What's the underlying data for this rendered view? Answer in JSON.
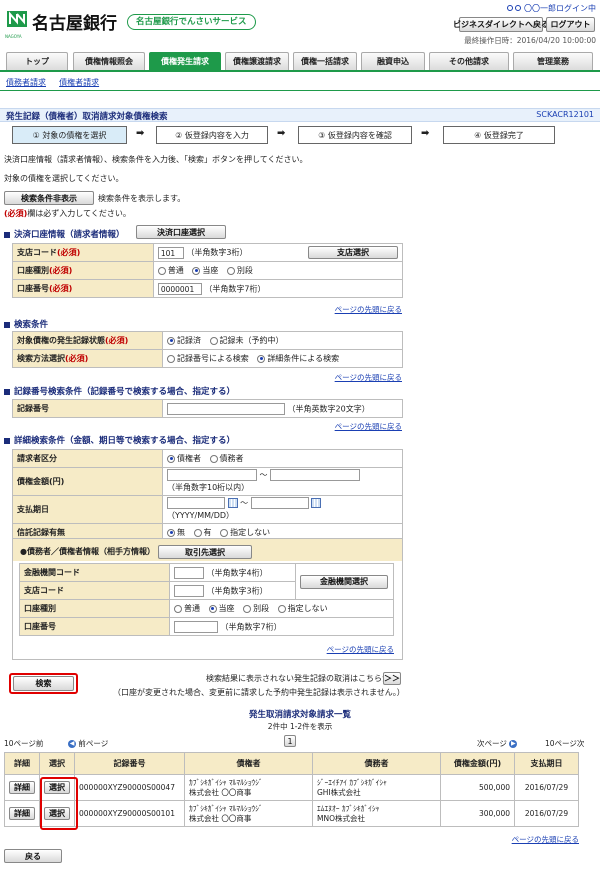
{
  "header": {
    "bank_name": "名古屋銀行",
    "logo_sub": "NAGOYA",
    "service_badge": "名古屋銀行でんさいサービス",
    "user_login": "〇〇一郎ログイン中",
    "business_direct_back": "ビジネスダイレクトへ戻る",
    "logout": "ログアウト",
    "last_operation": "最終操作日時：2016/04/20 10:00:00"
  },
  "tabs": [
    {
      "label": "トップ"
    },
    {
      "label": "債権情報照会"
    },
    {
      "label": "債権発生請求"
    },
    {
      "label": "債権譲渡請求"
    },
    {
      "label": "債権一括請求"
    },
    {
      "label": "融資申込"
    },
    {
      "label": "その他請求"
    },
    {
      "label": "管理業務"
    }
  ],
  "subnav": [
    "債務者請求",
    "債権者請求"
  ],
  "page": {
    "title": "発生記録（債権者）取消請求対象債権検索",
    "screen_id": "SCKACR12101",
    "steps": [
      "① 対象の債権を選択",
      "② 仮登録内容を入力",
      "③ 仮登録内容を確認",
      "④ 仮登録完了"
    ],
    "arrow": "➡",
    "instruction1": "決済口座情報（請求者情報）、検索条件を入力後、「検索」ボタンを押してください。",
    "instruction2": "対象の債権を選択してください。",
    "toggle_button": "検索条件非表示",
    "toggle_text": "検索条件を表示します。",
    "required_mark": "(必須)",
    "required_text": "欄は必ず入力してください。",
    "to_top": "ページの先頭に戻る"
  },
  "account_section": {
    "title": "決済口座情報（請求者情報）",
    "select_button": "決済口座選択",
    "branch_label": "支店コード",
    "branch_value": "101",
    "branch_hint": "（半角数字3桁）",
    "branch_button": "支店選択",
    "type_label": "口座種別",
    "type_options": [
      "普通",
      "当座",
      "別段"
    ],
    "number_label": "口座番号",
    "number_value": "0000001",
    "number_hint": "（半角数字7桁）"
  },
  "search_section": {
    "title": "検索条件",
    "status_label": "対象債権の発生記録状態",
    "status_options": [
      "記録済",
      "記録未（予約中）"
    ],
    "method_label": "検索方法選択",
    "method_options": [
      "記録番号による検索",
      "詳細条件による検索"
    ]
  },
  "record_section": {
    "title": "記録番号検索条件（記録番号で検索する場合、指定する）",
    "label": "記録番号",
    "hint": "（半角英数字20文字）"
  },
  "detail_section": {
    "title": "詳細検索条件（金額、期日等で検索する場合、指定する）",
    "requester_label": "請求者区分",
    "requester_options": [
      "債権者",
      "債務者"
    ],
    "amount_label": "債権金額(円)",
    "amount_hint": "（半角数字10桁以内）",
    "tilde": "～",
    "date_label": "支払期日",
    "date_hint": "（YYYY/MM/DD）",
    "trust_label": "信託記録有無",
    "trust_options": [
      "無",
      "有",
      "指定しない"
    ],
    "party_title": "●債務者／債権者情報（相手方情報）",
    "party_button": "取引先選択",
    "bank_code_label": "金融機関コード",
    "bank_code_hint": "（半角数字4桁）",
    "bank_button": "金融機関選択",
    "branch_label": "支店コード",
    "branch_hint": "（半角数字3桁）",
    "type_label": "口座種別",
    "type_options": [
      "普通",
      "当座",
      "別段",
      "指定しない"
    ],
    "number_label": "口座番号",
    "number_hint": "（半角数字7桁）"
  },
  "search_button": "検索",
  "note_line1": "検索結果に表示されない発生記録の取消はこちらから",
  "note_button": "＞＞",
  "note_line2": "（口座が変更された場合、変更前に請求した予約中発生記録は表示されません。）",
  "results": {
    "title": "発生取消請求対象請求一覧",
    "count": "2件中 1-2件を表示",
    "prev10": "10ページ前",
    "prev": "前ページ",
    "page": "1",
    "next": "次ページ",
    "next10": "10ページ次",
    "columns": [
      "詳細",
      "選択",
      "記録番号",
      "債権者",
      "債務者",
      "債権金額(円)",
      "支払期日"
    ],
    "rows": [
      {
        "detail": "詳細",
        "select": "選択",
        "record_no": "000000XYZ90000S00047",
        "creditor_kana": "ｶﾌﾞｼｷｶﾞｲｼｬ ﾏﾙﾏﾙｼｮｳｼﾞ",
        "creditor": "株式会社 〇〇商事",
        "debtor_kana": "ｼﾞｰｴｲﾁｱｲ ｶﾌﾞｼｷｶﾞｲｼｬ",
        "debtor": "GHI株式会社",
        "amount": "500,000",
        "due": "2016/07/29"
      },
      {
        "detail": "詳細",
        "select": "選択",
        "record_no": "000000XYZ90000S00101",
        "creditor_kana": "ｶﾌﾞｼｷｶﾞｲｼｬ ﾏﾙﾏﾙｼｮｳｼﾞ",
        "creditor": "株式会社 〇〇商事",
        "debtor_kana": "ｴﾑｴﾇｵｰ ｶﾌﾞｼｷｶﾞｲｼｬ",
        "debtor": "MNO株式会社",
        "amount": "300,000",
        "due": "2016/07/29"
      }
    ]
  },
  "back_button": "戻る",
  "colors": {
    "brand_green": "#1e9a4a",
    "navy": "#1b2c7a",
    "label_bg": "#f6ebc7",
    "highlight": "#e00000"
  }
}
